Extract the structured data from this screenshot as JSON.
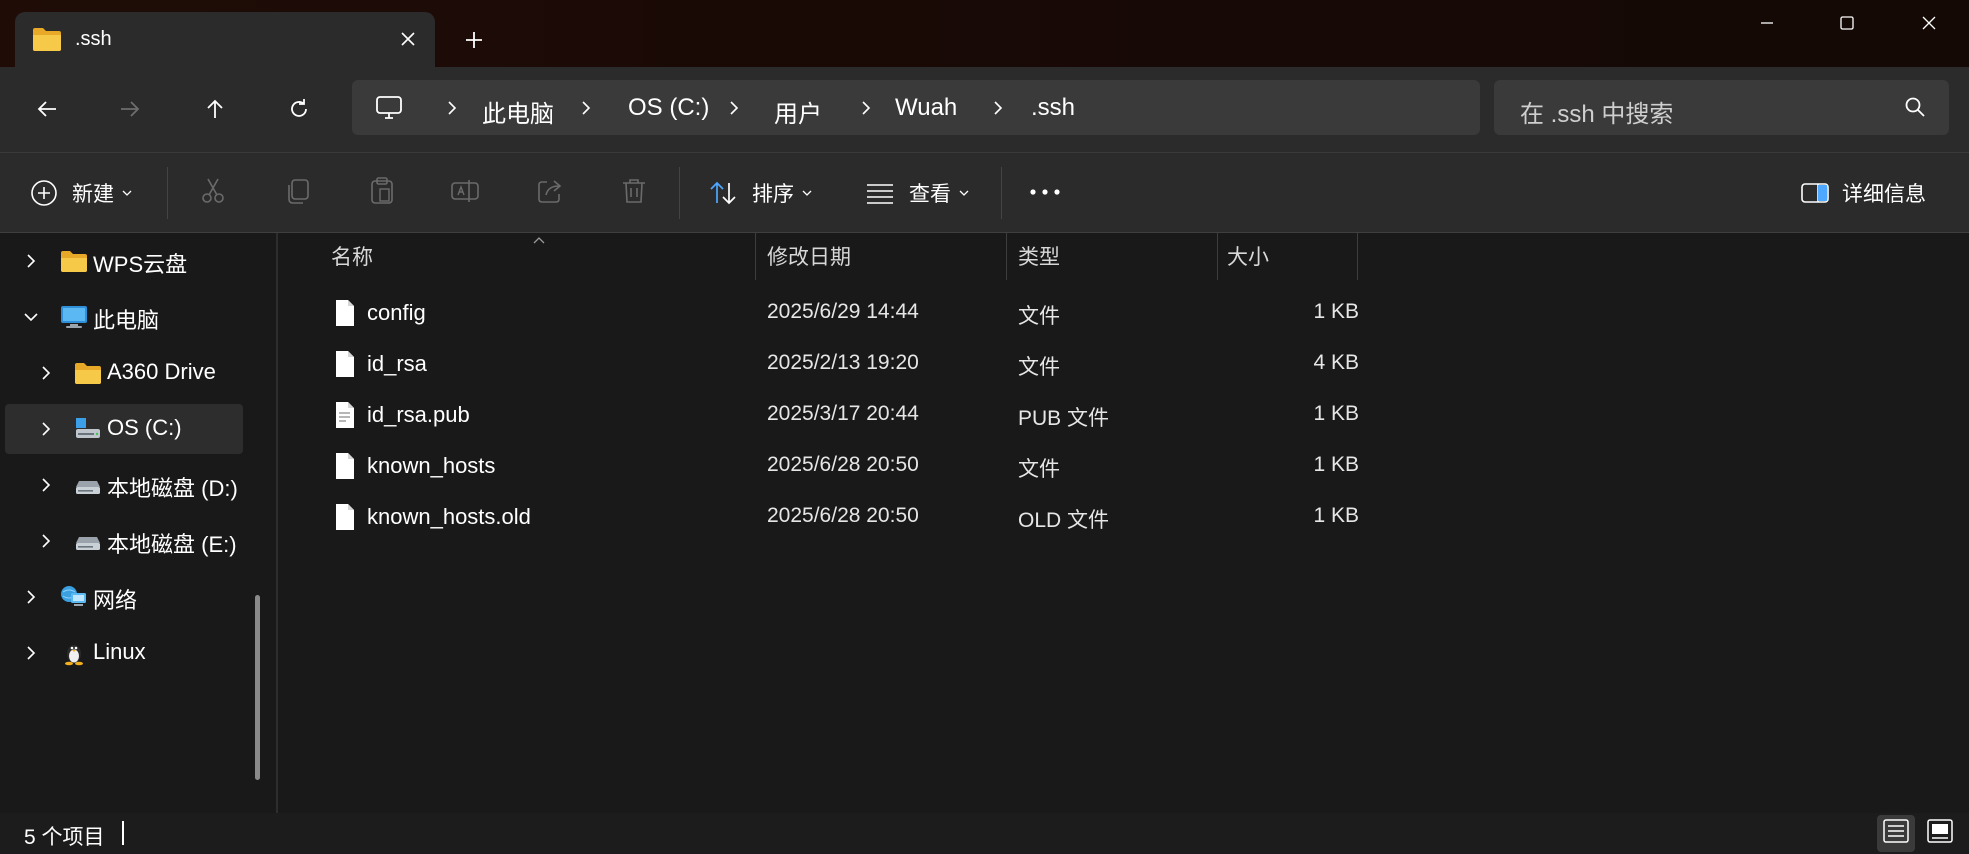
{
  "titlebar": {
    "tab_title": ".ssh",
    "new_tab_symbol": "+",
    "icons": [
      "folder-icon",
      "close-icon",
      "plus-icon",
      "minimize-icon",
      "maximize-icon",
      "window-close-icon"
    ]
  },
  "navbar": {
    "breadcrumb": [
      "此电脑",
      "OS (C:)",
      "用户",
      "Wuah",
      ".ssh"
    ],
    "search_placeholder": "在 .ssh 中搜索"
  },
  "command_bar": {
    "new_label": "新建",
    "sort_label": "排序",
    "view_label": "查看",
    "details_label": "详细信息",
    "icons": [
      "cut-icon",
      "copy-icon",
      "paste-icon",
      "rename-icon",
      "share-icon",
      "delete-icon",
      "more-icon"
    ]
  },
  "nav_tree": [
    {
      "label": "WPS云盘",
      "icon": "folder-icon",
      "expanded": false,
      "selected": false
    },
    {
      "label": "此电脑",
      "icon": "pc-icon",
      "expanded": true,
      "selected": false
    },
    {
      "label": "A360 Drive",
      "icon": "folder-icon",
      "expanded": false,
      "selected": false
    },
    {
      "label": "OS (C:)",
      "icon": "system-drive-icon",
      "expanded": false,
      "selected": true
    },
    {
      "label": "本地磁盘 (D:)",
      "icon": "drive-icon",
      "expanded": false,
      "selected": false
    },
    {
      "label": "本地磁盘 (E:)",
      "icon": "drive-icon",
      "expanded": false,
      "selected": false
    },
    {
      "label": "网络",
      "icon": "network-icon",
      "expanded": false,
      "selected": false
    },
    {
      "label": "Linux",
      "icon": "linux-icon",
      "expanded": false,
      "selected": false
    }
  ],
  "file_list": {
    "columns": {
      "name": "名称",
      "date": "修改日期",
      "type": "类型",
      "size": "大小"
    },
    "rows": [
      {
        "name": "config",
        "date": "2025/6/29 14:44",
        "type": "文件",
        "size": "1 KB",
        "icon": "file-icon"
      },
      {
        "name": "id_rsa",
        "date": "2025/2/13 19:20",
        "type": "文件",
        "size": "4 KB",
        "icon": "file-icon"
      },
      {
        "name": "id_rsa.pub",
        "date": "2025/3/17 20:44",
        "type": "PUB 文件",
        "size": "1 KB",
        "icon": "text-file-icon"
      },
      {
        "name": "known_hosts",
        "date": "2025/6/28 20:50",
        "type": "文件",
        "size": "1 KB",
        "icon": "file-icon"
      },
      {
        "name": "known_hosts.old",
        "date": "2025/6/28 20:50",
        "type": "OLD 文件",
        "size": "1 KB",
        "icon": "file-icon"
      }
    ]
  },
  "statusbar": {
    "item_count": "5 个项目"
  }
}
